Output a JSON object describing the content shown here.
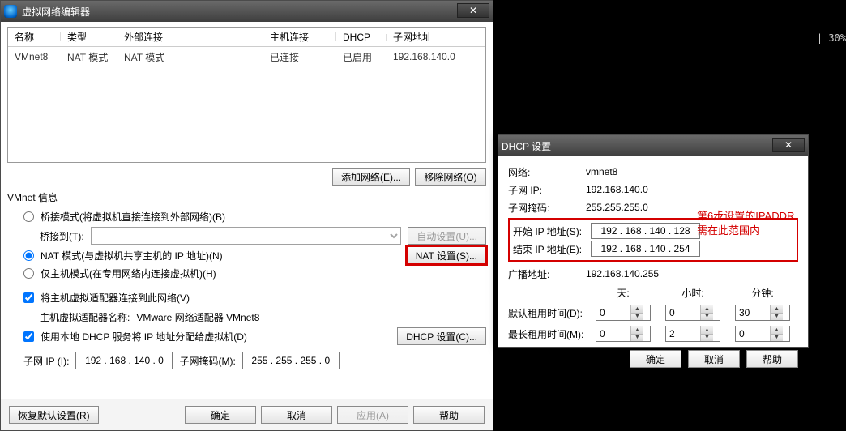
{
  "top_right": "|  30%",
  "main": {
    "title": "虚拟网络编辑器",
    "close_x": "✕",
    "columns": {
      "name": "名称",
      "type": "类型",
      "ext": "外部连接",
      "host": "主机连接",
      "dhcp": "DHCP",
      "subnet": "子网地址"
    },
    "row": {
      "name": "VMnet8",
      "type": "NAT 模式",
      "ext": "NAT 模式",
      "host": "已连接",
      "dhcp": "已启用",
      "subnet": "192.168.140.0"
    },
    "add_network": "添加网络(E)...",
    "remove_network": "移除网络(O)",
    "vmnet_info": "VMnet 信息",
    "bridged": "桥接模式(将虚拟机直接连接到外部网络)(B)",
    "bridge_to": "桥接到(T):",
    "auto_setting": "自动设置(U)...",
    "nat_mode": "NAT 模式(与虚拟机共享主机的 IP 地址)(N)",
    "nat_settings": "NAT 设置(S)...",
    "hostonly": "仅主机模式(在专用网络内连接虚拟机)(H)",
    "connect_host_adapter": "将主机虚拟适配器连接到此网络(V)",
    "host_adapter_name_label": "主机虚拟适配器名称:",
    "host_adapter_name_value": "VMware 网络适配器 VMnet8",
    "use_dhcp": "使用本地 DHCP 服务将 IP 地址分配给虚拟机(D)",
    "dhcp_settings": "DHCP 设置(C)...",
    "subnet_ip_label": "子网 IP (I):",
    "subnet_ip_value": "192 . 168 . 140 .  0",
    "subnet_mask_label": "子网掩码(M):",
    "subnet_mask_value": "255 . 255 . 255 .  0",
    "restore_defaults": "恢复默认设置(R)",
    "ok": "确定",
    "cancel": "取消",
    "apply": "应用(A)",
    "help": "帮助"
  },
  "dhcp": {
    "title": "DHCP 设置",
    "close_x": "✕",
    "network_label": "网络:",
    "network_value": "vmnet8",
    "subnet_ip_label": "子网 IP:",
    "subnet_ip_value": "192.168.140.0",
    "subnet_mask_label": "子网掩码:",
    "subnet_mask_value": "255.255.255.0",
    "start_ip_label": "开始 IP 地址(S):",
    "start_ip_value": "192 . 168 . 140 . 128",
    "end_ip_label": "结束 IP 地址(E):",
    "end_ip_value": "192 . 168 . 140 . 254",
    "broadcast_label": "广播地址:",
    "broadcast_value": "192.168.140.255",
    "days": "天:",
    "hours": "小时:",
    "minutes": "分钟:",
    "default_lease": "默认租用时间(D):",
    "max_lease": "最长租用时间(M):",
    "d_days": "0",
    "d_hours": "0",
    "d_min": "30",
    "m_days": "0",
    "m_hours": "2",
    "m_min": "0",
    "ok": "确定",
    "cancel": "取消",
    "help": "帮助"
  },
  "annotation": {
    "line1": "第6步设置的IPADDR",
    "line2": "需在此范围内"
  }
}
